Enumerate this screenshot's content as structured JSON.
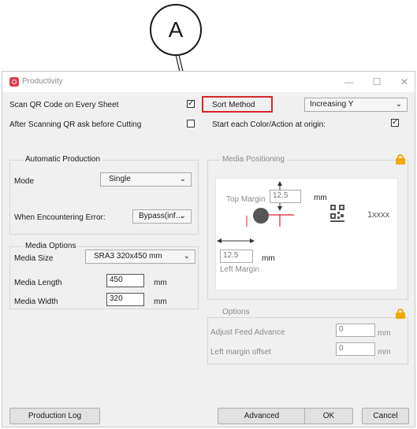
{
  "callout": {
    "label": "A"
  },
  "window": {
    "title": "Productivity",
    "minimize": "—",
    "maximize": "☐",
    "close": "✕"
  },
  "options_top": {
    "scan_qr_label": "Scan QR Code on Every Sheet",
    "scan_qr_checked": "✓",
    "after_scan_label": "After Scanning QR ask before Cutting",
    "after_scan_checked": "",
    "sort_method_label": "Sort Method",
    "sort_method_checked": "✓",
    "sort_method_value": "Increasing Y",
    "start_origin_label": "Start each Color/Action at origin:",
    "start_origin_checked": "✓"
  },
  "automatic_production": {
    "title": "Automatic Production",
    "mode_label": "Mode",
    "mode_value": "Single",
    "error_label": "When Encountering Error:",
    "error_value": "Bypass(inf…"
  },
  "media_options": {
    "title": "Media Options",
    "size_label": "Media Size",
    "size_value": "SRA3 320x450 mm",
    "length_label": "Media Length",
    "length_value": "450",
    "width_label": "Media Width",
    "width_value": "320",
    "unit": "mm"
  },
  "media_positioning": {
    "title": "Media Positioning",
    "top_margin_label": "Top Margin",
    "top_margin_value": "12.5",
    "left_margin_label": "Left Margin",
    "left_margin_value": "12.5",
    "unit": "mm",
    "qr_text": "1xxxx"
  },
  "options_box": {
    "title": "Options",
    "feed_label": "Adjust Feed Advance",
    "feed_value": "0",
    "offset_label": "Left margin offset",
    "offset_value": "0",
    "unit": "mm"
  },
  "buttons": {
    "production_log": "Production Log",
    "advanced": "Advanced",
    "ok": "OK",
    "cancel": "Cancel"
  },
  "dropdown_arrow": "⌄",
  "colors": {
    "highlight": "#d9262e",
    "lock": "#f2a900",
    "accent_icon": "#e03a4e"
  }
}
